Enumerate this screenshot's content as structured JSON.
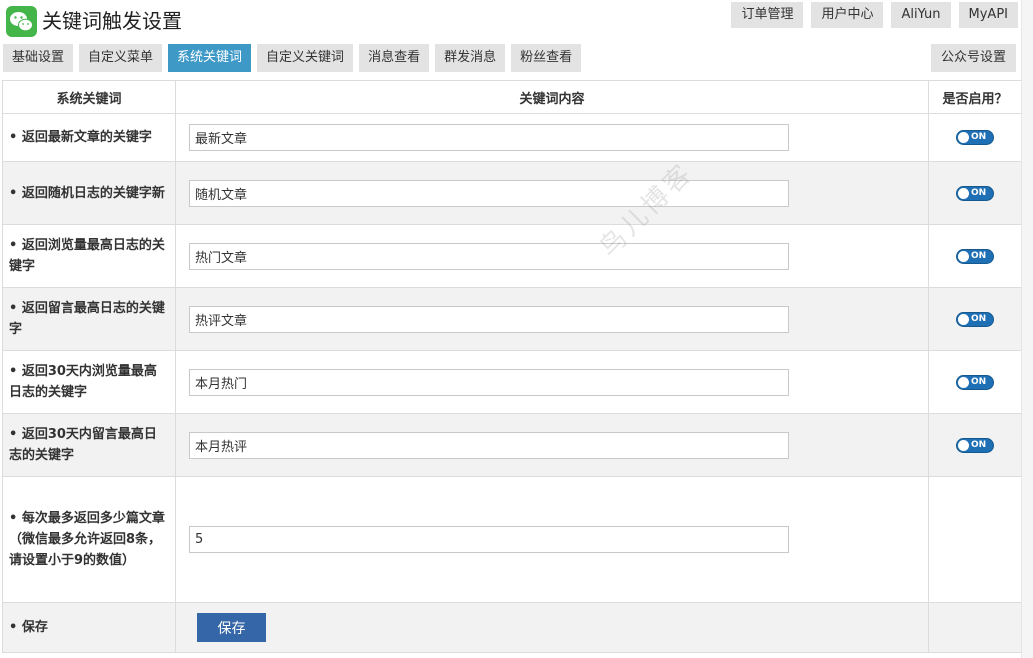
{
  "header": {
    "title": "关键词触发设置",
    "top_links": [
      "订单管理",
      "用户中心",
      "AliYun",
      "MyAPI"
    ]
  },
  "tabs": {
    "items": [
      "基础设置",
      "自定义菜单",
      "系统关键词",
      "自定义关键词",
      "消息查看",
      "群发消息",
      "粉丝查看"
    ],
    "active": "系统关键词",
    "right": "公众号设置"
  },
  "table": {
    "headers": [
      "系统关键词",
      "关键词内容",
      "是否启用？"
    ],
    "rows": [
      {
        "label": "• 返回最新文章的关键字",
        "value": "最新文章",
        "toggle": "ON"
      },
      {
        "label": "• 返回随机日志的关键字新",
        "value": "随机文章",
        "toggle": "ON"
      },
      {
        "label": "• 返回浏览量最高日志的关键字",
        "value": "热门文章",
        "toggle": "ON"
      },
      {
        "label": "• 返回留言最高日志的关键字",
        "value": "热评文章",
        "toggle": "ON"
      },
      {
        "label": "• 返回30天内浏览量最高日志的关键字",
        "value": "本月热门",
        "toggle": "ON"
      },
      {
        "label": "• 返回30天内留言最高日志的关键字",
        "value": "本月热评",
        "toggle": "ON"
      }
    ],
    "max_row": {
      "label_1": "• 每次最多返回多少篇文章",
      "label_2": "（微信最多允许返回8条，请设置小于9的数值）",
      "value": "5"
    },
    "save_row": {
      "label": "• 保存",
      "button": "保存"
    }
  },
  "watermark": "鸟儿博客",
  "colors": {
    "accent": "#3f99c7",
    "logo": "#44b549",
    "save_button": "#3566a8",
    "toggle": "#1e6fb3"
  }
}
